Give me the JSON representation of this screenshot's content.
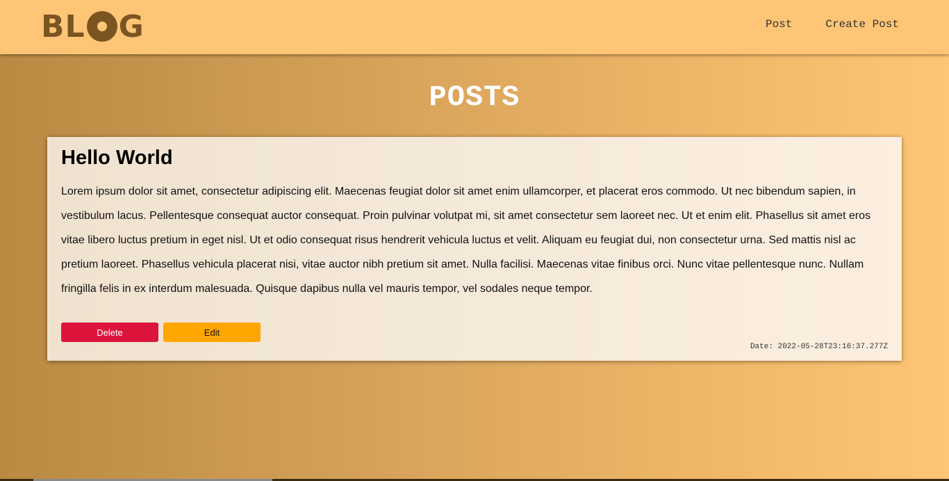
{
  "brand": {
    "logo_text_before": "BL",
    "logo_text_after": "G"
  },
  "nav": {
    "links": [
      {
        "label": "Post"
      },
      {
        "label": "Create Post"
      }
    ]
  },
  "page": {
    "title": "POSTS"
  },
  "posts": [
    {
      "title": "Hello World",
      "body": "Lorem ipsum dolor sit amet, consectetur adipiscing elit. Maecenas feugiat dolor sit amet enim ullamcorper, et placerat eros commodo. Ut nec bibendum sapien, in vestibulum lacus. Pellentesque consequat auctor consequat. Proin pulvinar volutpat mi, sit amet consectetur sem laoreet nec. Ut et enim elit. Phasellus sit amet eros vitae libero luctus pretium in eget nisl. Ut et odio consequat risus hendrerit vehicula luctus et velit. Aliquam eu feugiat dui, non consectetur urna. Sed mattis nisl ac pretium laoreet. Phasellus vehicula placerat nisi, vitae auctor nibh pretium sit amet. Nulla facilisi. Maecenas vitae finibus orci. Nunc vitae pellentesque nunc. Nullam fringilla felis in ex interdum malesuada. Quisque dapibus nulla vel mauris tempor, vel sodales neque tempor.",
      "delete_label": "Delete",
      "edit_label": "Edit",
      "date": "Date: 2022-05-28T23:16:37.277Z"
    }
  ],
  "colors": {
    "navbar": "#ffc576",
    "logo": "#7a5522",
    "delete_button": "#dc143c",
    "edit_button": "#ffa500"
  }
}
